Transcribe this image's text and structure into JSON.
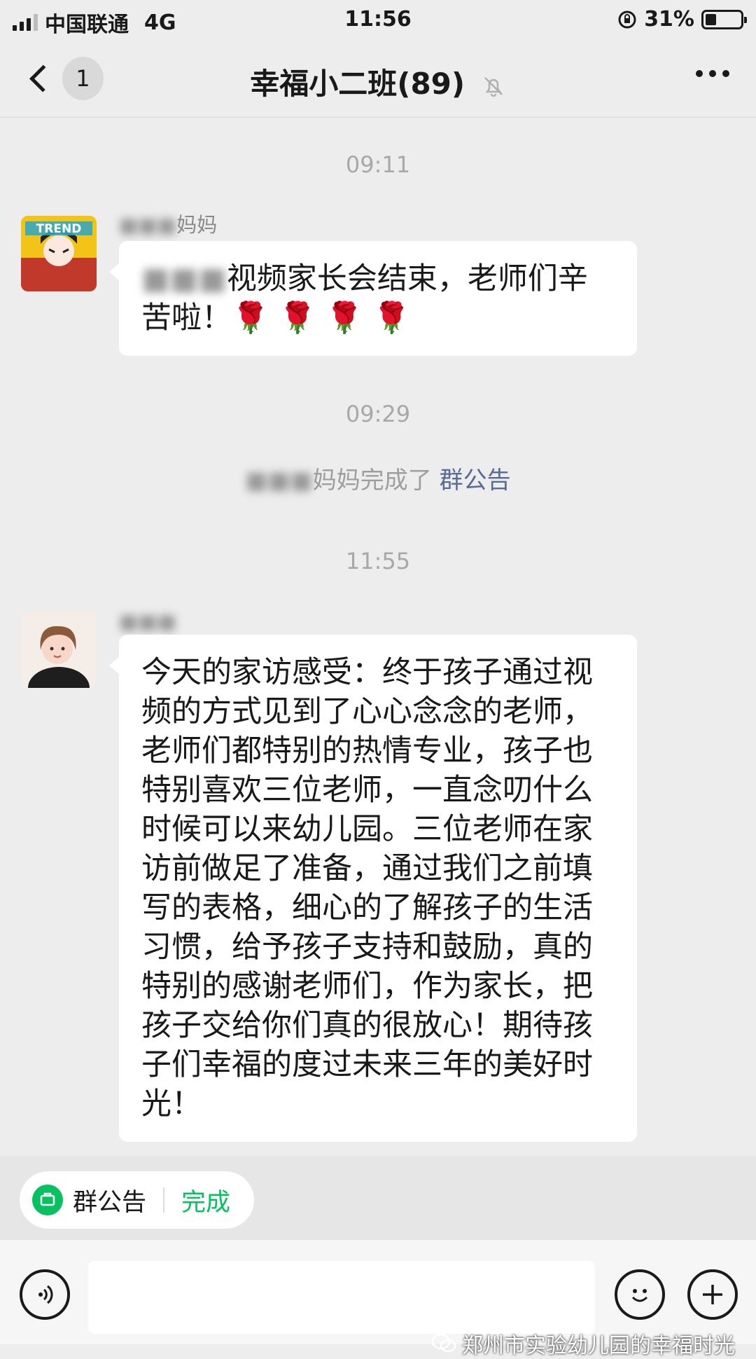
{
  "status_bar": {
    "carrier": "中国联通",
    "network": "4G",
    "time": "11:56",
    "battery_percent": "31%",
    "battery_level": 0.31
  },
  "nav": {
    "back_icon": "chevron-left-icon",
    "unread_count": "1",
    "title": "幸福小二班(89)",
    "mute_icon": "bell-slash-icon",
    "more_icon": "more-dots-icon"
  },
  "chat": {
    "timestamps": [
      "09:11",
      "09:29",
      "11:55"
    ],
    "messages": [
      {
        "sender_visible": "妈妈",
        "text_visible": "视频家长会结束，老师们辛苦啦！",
        "emoji": "🌹 🌹 🌹 🌹"
      },
      {
        "text": "今天的家访感受：终于孩子通过视频的方式见到了心心念念的老师，老师们都特别的热情专业，孩子也特别喜欢三位老师，一直念叨什么时候可以来幼儿园。三位老师在家访前做足了准备，通过我们之前填写的表格，细心的了解孩子的生活习惯，给予孩子支持和鼓励，真的特别的感谢老师们，作为家长，把孩子交给你们真的很放心！期待孩子们幸福的度过未来三年的美好时光！"
      }
    ],
    "system_message": {
      "text": "妈妈完成了",
      "link": "群公告"
    }
  },
  "notice_bar": {
    "label": "群公告",
    "action": "完成",
    "accent_color": "#07c160"
  },
  "input_bar": {
    "voice_icon": "voice-icon",
    "emoji_icon": "emoji-icon",
    "plus_icon": "plus-icon"
  },
  "watermark": "郑州市实验幼儿园的幸福时光"
}
